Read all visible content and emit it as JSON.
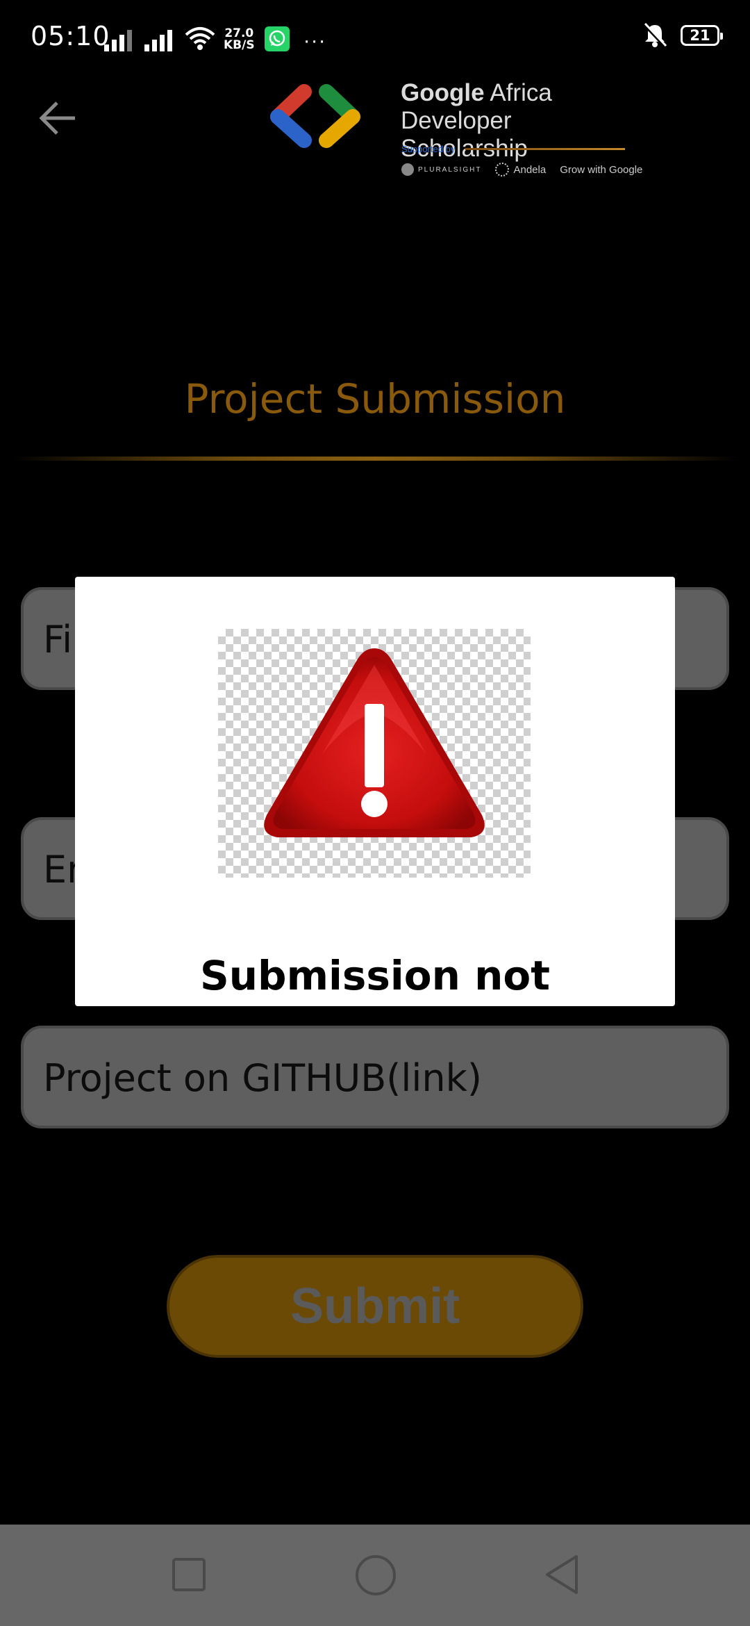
{
  "status_bar": {
    "time": "05:10",
    "net_speed_value": "27.0",
    "net_speed_unit": "KB/S",
    "more": "···",
    "battery_level": "21"
  },
  "header": {
    "logo_line1_bold": "Google",
    "logo_line1_rest": " Africa",
    "logo_line2": "Developer Scholarship",
    "supported_by": "Supported by",
    "partners": [
      "PLURALSIGHT",
      "Andela",
      "Grow with Google"
    ]
  },
  "page": {
    "title": "Project Submission",
    "title_color": "#8a5a0c"
  },
  "form": {
    "field1_visible_text": "Fi",
    "field2_visible_text": "Er",
    "field3_placeholder": "Project on GITHUB(link)",
    "submit_label": "Submit",
    "submit_color": "#6b4a06"
  },
  "dialog": {
    "icon": "warning-icon",
    "message": "Submission not Successful"
  },
  "nav_bar": {
    "icons": [
      "recent-apps-icon",
      "home-icon",
      "back-icon"
    ]
  }
}
